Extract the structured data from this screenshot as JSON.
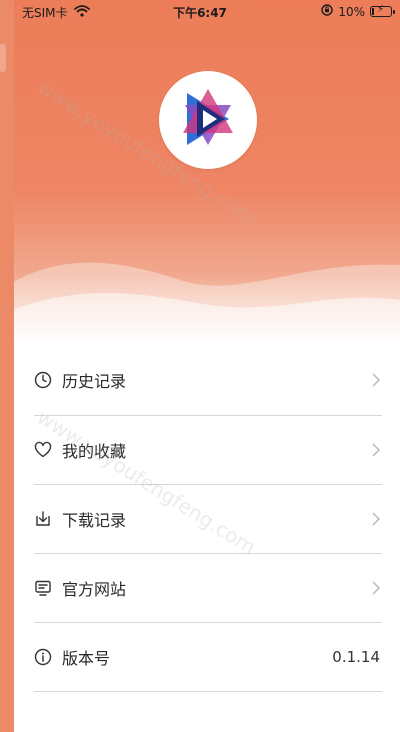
{
  "status_bar": {
    "carrier": "无SIM卡",
    "time": "下午6:47",
    "battery_percent": "10%",
    "battery_level": 0.1
  },
  "logo": {
    "icon": "play-logo-icon"
  },
  "menu": {
    "items": [
      {
        "label": "历史记录",
        "icon": "clock-icon"
      },
      {
        "label": "我的收藏",
        "icon": "heart-icon"
      },
      {
        "label": "下载记录",
        "icon": "download-icon"
      },
      {
        "label": "官方网站",
        "icon": "website-icon"
      },
      {
        "label": "版本号",
        "icon": "info-icon",
        "value": "0.1.14"
      }
    ]
  },
  "watermark": "www.yeyoufengfeng.com",
  "colors": {
    "accent": "#ec7d58",
    "divider": "#d6d6d6",
    "text": "#2a2a2a"
  }
}
